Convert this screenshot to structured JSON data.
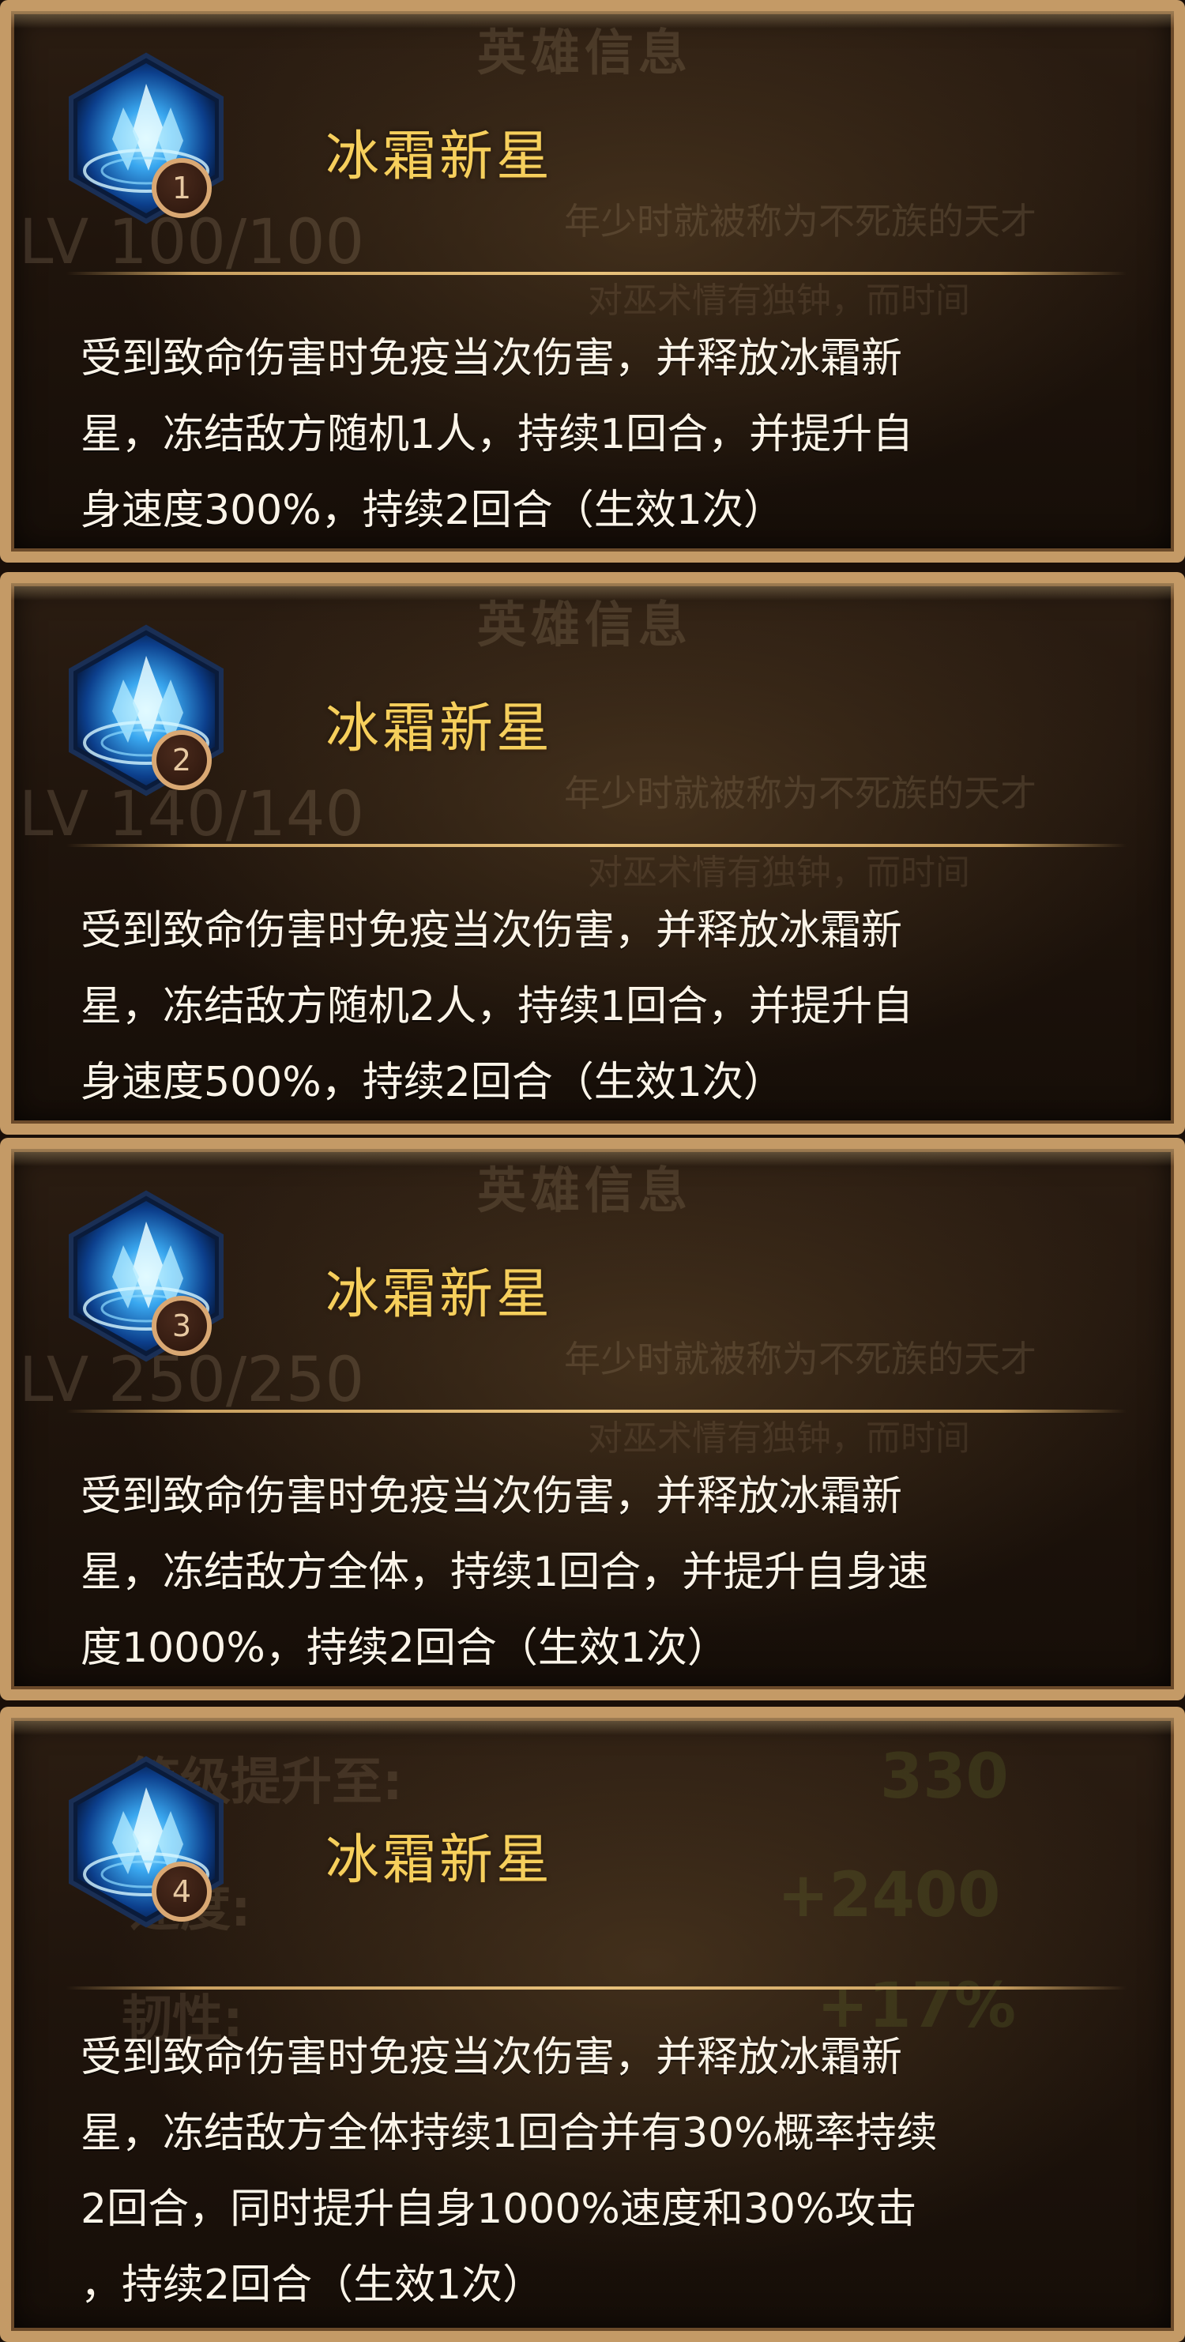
{
  "background_texts": {
    "hero_info_title": "英雄信息",
    "level_texts": [
      "LV 100/100",
      "LV 140/140",
      "LV 250/250"
    ],
    "lore_line1": "年少时就被称为不死族的天才",
    "lore_line2": "对巫术情有独钟，而时间",
    "stat_labels": [
      "等级提升至:",
      "速度:",
      "韧性:"
    ],
    "stat_values": [
      "330",
      "+2400",
      "+17%"
    ]
  },
  "skills": [
    {
      "name": "冰霜新星",
      "rank": "1",
      "icon": "ice-crystal-icon",
      "description_lines": [
        "受到致命伤害时免疫当次伤害，并释放冰霜新",
        "星，冻结敌方随机1人，持续1回合，并提升自",
        "身速度300%，持续2回合（生效1次）"
      ]
    },
    {
      "name": "冰霜新星",
      "rank": "2",
      "icon": "ice-crystal-icon",
      "description_lines": [
        "受到致命伤害时免疫当次伤害，并释放冰霜新",
        "星，冻结敌方随机2人，持续1回合，并提升自",
        "身速度500%，持续2回合（生效1次）"
      ]
    },
    {
      "name": "冰霜新星",
      "rank": "3",
      "icon": "ice-crystal-icon",
      "description_lines": [
        "受到致命伤害时免疫当次伤害，并释放冰霜新",
        "星，冻结敌方全体，持续1回合，并提升自身速",
        "度1000%，持续2回合（生效1次）"
      ]
    },
    {
      "name": "冰霜新星",
      "rank": "4",
      "icon": "ice-crystal-icon",
      "description_lines": [
        "受到致命伤害时免疫当次伤害，并释放冰霜新",
        "星，冻结敌方全体持续1回合并有30%概率持续",
        "2回合，同时提升自身1000%速度和30%攻击",
        "，持续2回合（生效1次）"
      ]
    }
  ],
  "colors": {
    "frame": "#c49a66",
    "skill_name": "#f6cf5c",
    "description": "#fbf4e8",
    "card_bg": "#1f140c"
  }
}
